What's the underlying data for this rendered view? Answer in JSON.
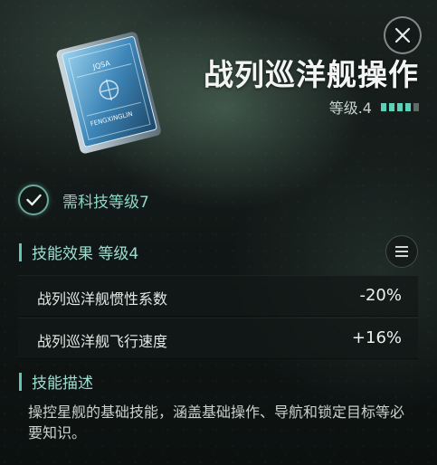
{
  "header": {
    "title": "战列巡洋舰操作",
    "level_label": "等级.4",
    "level_current": 4,
    "level_max": 5
  },
  "close_button": {
    "icon": "close-icon"
  },
  "card": {
    "icon": "skillbook-card",
    "text_top": "JQSA",
    "text_mid": "FENGXINGLIN"
  },
  "requirement": {
    "icon": "check-circle-icon",
    "text": "需科技等级7"
  },
  "effects_section": {
    "title": "技能效果 等级4",
    "menu_icon": "list-menu-icon"
  },
  "stats": [
    {
      "name": "战列巡洋舰惯性系数",
      "value": "-20%"
    },
    {
      "name": "战列巡洋舰飞行速度",
      "value": "+16%"
    }
  ],
  "description_section": {
    "title": "技能描述",
    "text": "操控星舰的基础技能，涵盖基础操作、导航和锁定目标等必要知识。"
  },
  "colors": {
    "accent": "#5fc7b2",
    "text_accent": "#9dded1",
    "pip_on": "#5fd0b8",
    "pip_off": "#5e6b66"
  }
}
